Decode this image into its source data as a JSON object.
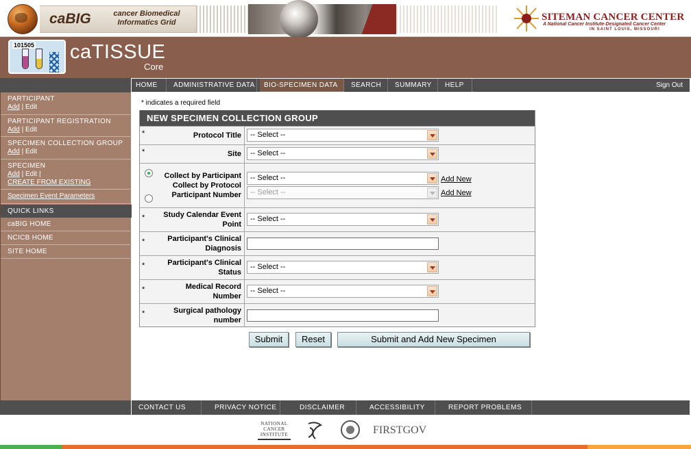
{
  "banner": {
    "cabig": "caBIG",
    "cabig_sub_1": "cancer Biomedical",
    "cabig_sub_2": "Informatics Grid",
    "siteman_title": "SITEMAN CANCER CENTER",
    "siteman_sub": "A National Cancer Institute-Designated Cancer Center",
    "siteman_loc": "IN SAINT LOUIS, MISSOURI"
  },
  "app": {
    "icon_id": "101505",
    "title": "caTISSUE",
    "subtitle": "Core"
  },
  "topnav": {
    "items": [
      "HOME",
      "ADMINISTRATIVE DATA",
      "BIO-SPECIMEN DATA",
      "SEARCH",
      "SUMMARY",
      "HELP"
    ],
    "active": "BIO-SPECIMEN DATA",
    "signout": "Sign Out"
  },
  "sidebar": {
    "participant": {
      "title": "PARTICIPANT",
      "add": "Add",
      "sep": "|",
      "edit": "Edit"
    },
    "participant_registration": {
      "title": "PARTICIPANT REGISTRATION",
      "add": "Add",
      "sep": "|",
      "edit": "Edit"
    },
    "scg": {
      "title": "SPECIMEN COLLECTION GROUP",
      "add": "Add",
      "sep": "|",
      "edit": "Edit"
    },
    "specimen": {
      "title": "SPECIMEN",
      "add": "Add",
      "sep": "|",
      "edit": "Edit",
      "sep2": "|",
      "create_from_existing": "CREATE FROM EXISTING"
    },
    "specimen_event_parameters": "Specimen Event Parameters",
    "quick_links": "QUICK LINKS",
    "links": [
      "caBIG HOME",
      "NCICB HOME",
      "SITE HOME"
    ]
  },
  "form": {
    "required_note": "* indicates a required field",
    "header": "NEW SPECIMEN COLLECTION GROUP",
    "req_mark": "*",
    "protocol_title": {
      "label": "Protocol Title",
      "value": "-- Select --"
    },
    "site": {
      "label": "Site",
      "value": "-- Select --"
    },
    "collect_by_participant": {
      "label": "Collect by Participant",
      "value": "-- Select --",
      "add_new": "Add New"
    },
    "collect_by_protocol": {
      "label_1": "Collect by Protocol",
      "label_2": "Participant Number",
      "value": "-- Select --",
      "add_new": "Add New"
    },
    "study_calendar": {
      "label_1": "Study Calendar Event",
      "label_2": "Point",
      "value": "-- Select --"
    },
    "clinical_diagnosis": {
      "label_1": "Participant's Clinical",
      "label_2": "Diagnosis",
      "value": ""
    },
    "clinical_status": {
      "label_1": "Participant's Clinical",
      "label_2": "Status",
      "value": "-- Select --"
    },
    "medical_record": {
      "label_1": "Medical Record",
      "label_2": "Number",
      "value": "-- Select --"
    },
    "surgical_pathology": {
      "label_1": "Surgical pathology",
      "label_2": "number",
      "value": ""
    },
    "buttons": {
      "submit": "Submit",
      "reset": "Reset",
      "submit_add": "Submit and Add New Specimen"
    }
  },
  "footer": {
    "items": [
      "CONTACT US",
      "PRIVACY NOTICE",
      "DISCLAIMER",
      "ACCESSIBILITY",
      "REPORT PROBLEMS"
    ],
    "nci_logo_text": "NATIONAL CANCER INSTITUTE",
    "firstgov": "FIRSTGOV"
  },
  "colors": {
    "header_brown": "#8a5e4d",
    "sidebar_brown": "#a47f6c",
    "nav_gray": "#4f4f4f",
    "active_tab": "#7a5848",
    "siteman_red": "#8b1e1a"
  },
  "icons": [
    "globe-icon",
    "test-tubes-icon",
    "dna-helix-icon",
    "siteman-logo-icon",
    "hhs-logo-icon",
    "nih-seal-icon",
    "select-arrow-icon"
  ]
}
